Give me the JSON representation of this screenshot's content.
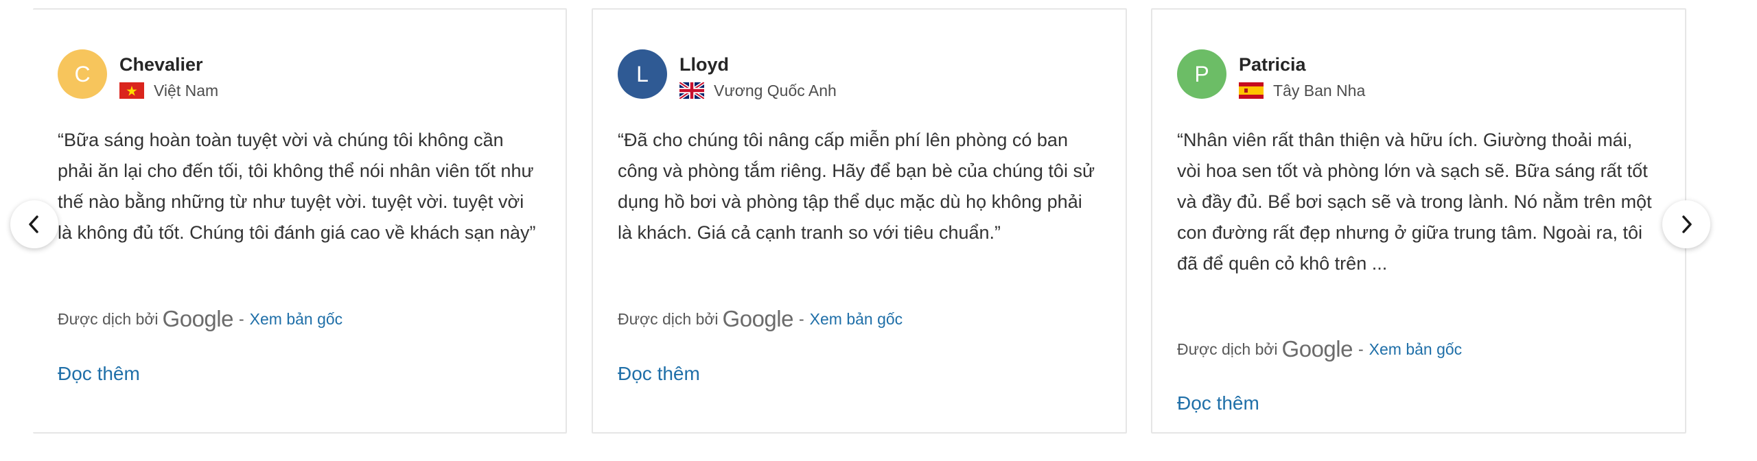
{
  "reviews": [
    {
      "avatar_letter": "C",
      "avatar_color": "#f7c55c",
      "name": "Chevalier",
      "country": "Việt Nam",
      "flag_icon": "vietnam-flag-icon",
      "text": "“Bữa sáng hoàn toàn tuyệt vời và chúng tôi không cần phải ăn lại cho đến tối, tôi không thể nói nhân viên tốt như thế nào bằng những từ như tuyệt vời. tuyệt vời. tuyệt vời là không đủ tốt. Chúng tôi đánh giá cao về khách sạn này”",
      "translated_by": "Được dịch bởi",
      "google": "Google",
      "separator": "-",
      "view_original": "Xem bản gốc",
      "read_more": "Đọc thêm"
    },
    {
      "avatar_letter": "L",
      "avatar_color": "#2f5a94",
      "name": "Lloyd",
      "country": "Vương Quốc Anh",
      "flag_icon": "uk-flag-icon",
      "text": "“Đã cho chúng tôi nâng cấp miễn phí lên phòng có ban công và phòng tắm riêng. Hãy để bạn bè của chúng tôi sử dụng hồ bơi và phòng tập thể dục mặc dù họ không phải là khách. Giá cả cạnh tranh so với tiêu chuẩn.”",
      "translated_by": "Được dịch bởi",
      "google": "Google",
      "separator": "-",
      "view_original": "Xem bản gốc",
      "read_more": "Đọc thêm"
    },
    {
      "avatar_letter": "P",
      "avatar_color": "#6cbd66",
      "name": "Patricia",
      "country": "Tây Ban Nha",
      "flag_icon": "spain-flag-icon",
      "text": "“Nhân viên rất thân thiện và hữu ích. Giường thoải mái, vòi hoa sen tốt và phòng lớn và sạch sẽ. Bữa sáng rất tốt và đầy đủ. Bể bơi sạch sẽ và trong lành. Nó nằm trên một con đường rất đẹp nhưng ở giữa trung tâm. Ngoài ra, tôi đã để quên cỏ khô trên ...",
      "translated_by": "Được dịch bởi",
      "google": "Google",
      "separator": "-",
      "view_original": "Xem bản gốc",
      "read_more": "Đọc thêm"
    }
  ],
  "nav": {
    "prev_icon": "chevron-left-icon",
    "next_icon": "chevron-right-icon"
  },
  "colors": {
    "link": "#1f6fa8",
    "card_border": "#e6e6e6"
  }
}
